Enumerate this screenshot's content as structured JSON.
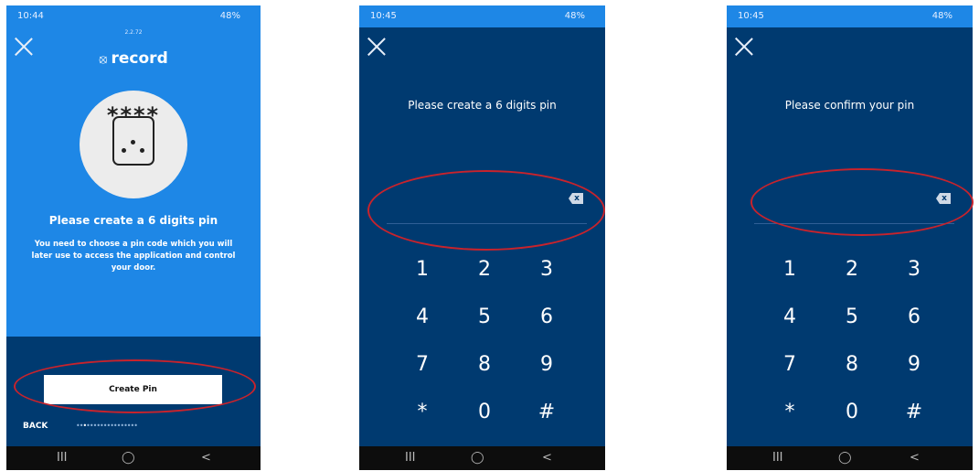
{
  "screen1": {
    "time": "10:44",
    "status_right": "48%",
    "version": "2.2.72",
    "logo_text": "record",
    "pin_icon_stars": "****",
    "title": "Please create a 6 digits pin",
    "description": "You need to choose a pin code which you will later use to access the application and control your door.",
    "create_button": "Create Pin",
    "back_label": "BACK",
    "progress_dots": "●●●●●●●●●●●●●●●●●●",
    "progress_step": 3,
    "progress_total": 18
  },
  "screen2": {
    "time": "10:45",
    "status_right": "48%",
    "prompt": "Please create a 6 digits pin",
    "pin_value": "",
    "backspace_glyph": "x"
  },
  "screen3": {
    "time": "10:45",
    "status_right": "48%",
    "prompt": "Please confirm your pin",
    "pin_value": "",
    "backspace_glyph": "x"
  },
  "keypad": [
    "1",
    "2",
    "3",
    "4",
    "5",
    "6",
    "7",
    "8",
    "9",
    "*",
    "0",
    "#"
  ],
  "navbar": {
    "recents": "III",
    "home": "◯",
    "back": "<"
  },
  "icons": {
    "close": "close-icon",
    "backspace": "backspace-icon",
    "logo": "record-logo-icon",
    "pinpad": "pinpad-icon"
  },
  "colors": {
    "primary_blue": "#1e87e6",
    "dark_navy": "#003a70",
    "highlight_red": "#c8232c",
    "navbar": "#0d0d0d"
  }
}
